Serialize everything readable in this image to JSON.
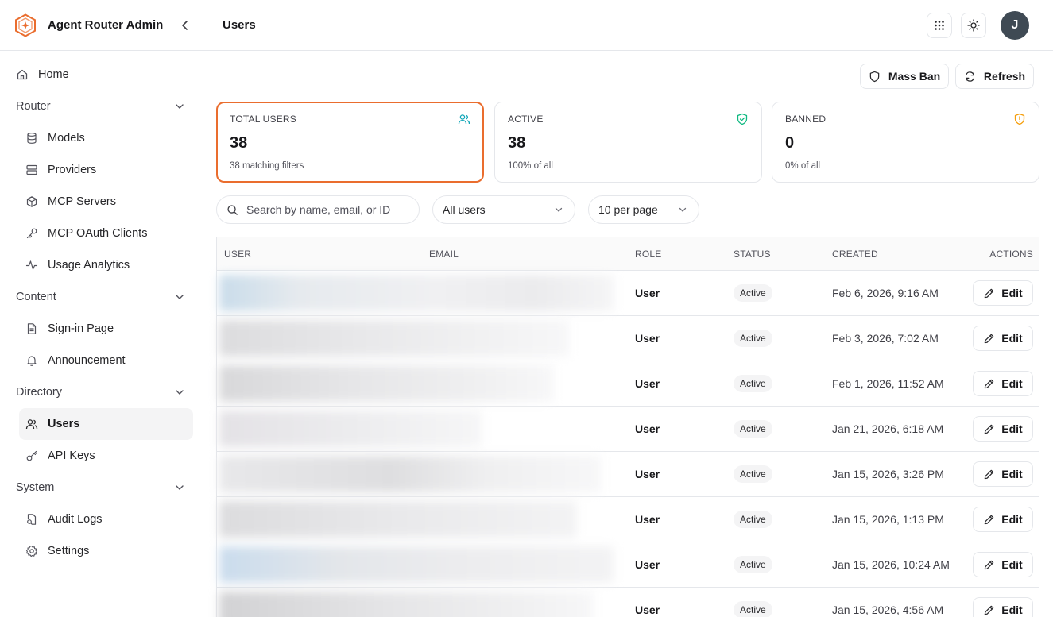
{
  "app": {
    "title": "Agent Router Admin"
  },
  "header": {
    "page_title": "Users",
    "avatar_initial": "J"
  },
  "sidebar": {
    "home": "Home",
    "groups": [
      {
        "label": "Router",
        "items": [
          "Models",
          "Providers",
          "MCP Servers",
          "MCP OAuth Clients",
          "Usage Analytics"
        ]
      },
      {
        "label": "Content",
        "items": [
          "Sign-in Page",
          "Announcement"
        ]
      },
      {
        "label": "Directory",
        "items": [
          "Users",
          "API Keys"
        ]
      },
      {
        "label": "System",
        "items": [
          "Audit Logs",
          "Settings"
        ]
      }
    ],
    "active_item": "Users"
  },
  "actions": {
    "mass_ban": "Mass Ban",
    "refresh": "Refresh"
  },
  "stats": [
    {
      "label": "TOTAL USERS",
      "value": "38",
      "sub": "38 matching filters",
      "icon": "users-icon",
      "color": "#0ea5b7"
    },
    {
      "label": "ACTIVE",
      "value": "38",
      "sub": "100% of all",
      "icon": "shield-check-icon",
      "color": "#10b981"
    },
    {
      "label": "BANNED",
      "value": "0",
      "sub": "0% of all",
      "icon": "shield-alert-icon",
      "color": "#f59e0b"
    }
  ],
  "filters": {
    "search_placeholder": "Search by name, email, or ID",
    "status_filter": "All users",
    "page_size": "10 per page"
  },
  "table": {
    "columns": [
      "USER",
      "EMAIL",
      "ROLE",
      "STATUS",
      "CREATED",
      "ACTIONS"
    ],
    "edit_label": "Edit",
    "rows": [
      {
        "role": "User",
        "status": "Active",
        "created": "Feb 6, 2026, 9:16 AM"
      },
      {
        "role": "User",
        "status": "Active",
        "created": "Feb 3, 2026, 7:02 AM"
      },
      {
        "role": "User",
        "status": "Active",
        "created": "Feb 1, 2026, 11:52 AM"
      },
      {
        "role": "User",
        "status": "Active",
        "created": "Jan 21, 2026, 6:18 AM"
      },
      {
        "role": "User",
        "status": "Active",
        "created": "Jan 15, 2026, 3:26 PM"
      },
      {
        "role": "User",
        "status": "Active",
        "created": "Jan 15, 2026, 1:13 PM"
      },
      {
        "role": "User",
        "status": "Active",
        "created": "Jan 15, 2026, 10:24 AM"
      },
      {
        "role": "User",
        "status": "Active",
        "created": "Jan 15, 2026, 4:56 AM"
      }
    ]
  },
  "colors": {
    "accent": "#ea6d2e",
    "border": "#e5e7eb",
    "text": "#18181b"
  }
}
